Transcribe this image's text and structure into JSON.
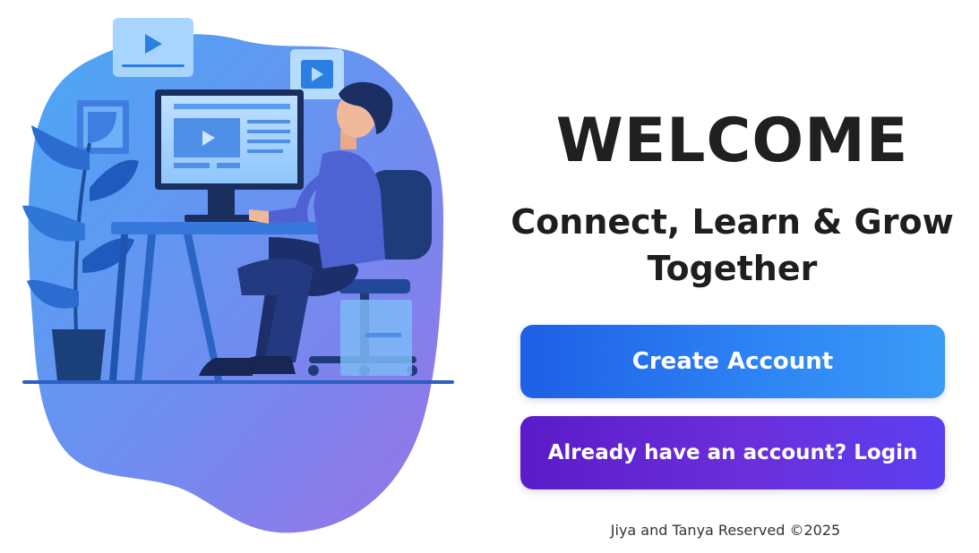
{
  "welcome": {
    "title": "WELCOME",
    "tagline_line1": "Connect, Learn & Grow",
    "tagline_line2": "Together"
  },
  "actions": {
    "create_account_label": "Create Account",
    "login_label": "Already have an account? Login"
  },
  "footer": {
    "text": "Jiya and Tanya Reserved  ©2025"
  },
  "colors": {
    "create_button": "#2a7bf0",
    "login_button": "#6428d6",
    "blob_start": "#4aa8f5",
    "blob_end": "#8f6ee8",
    "title_text": "#202020"
  },
  "illustration": {
    "icons": [
      "video-play-icon",
      "video-play-icon",
      "picture-frame-icon",
      "plant-icon",
      "monitor-icon",
      "person-icon",
      "office-chair-icon",
      "desk-icon"
    ]
  }
}
